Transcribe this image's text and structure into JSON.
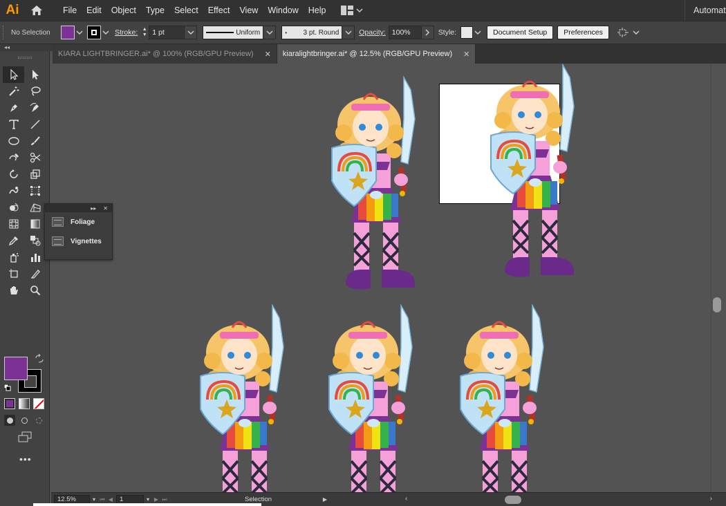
{
  "app": {
    "logo": "Ai",
    "workspace": "Automatic"
  },
  "menu": [
    "File",
    "Edit",
    "Object",
    "Type",
    "Select",
    "Effect",
    "View",
    "Window",
    "Help"
  ],
  "control": {
    "selection": "No Selection",
    "stroke_label": "Stroke:",
    "stroke_weight": "1 pt",
    "profile": "Uniform",
    "brush": "3 pt. Round",
    "opacity_label": "Opacity:",
    "opacity": "100%",
    "style_label": "Style:",
    "document_setup": "Document Setup",
    "preferences": "Preferences"
  },
  "colors": {
    "fill": "#7b3294",
    "stroke": "#000000",
    "accent": "#ff9a00"
  },
  "tabs": [
    {
      "label": "KIARA LIGHTBRINGER.ai* @ 100% (RGB/GPU Preview)",
      "active": false
    },
    {
      "label": "kiaralightbringer.ai* @ 12.5% (RGB/GPU Preview)",
      "active": true
    }
  ],
  "panel": {
    "items": [
      "Foliage",
      "Vignettes"
    ]
  },
  "status": {
    "zoom": "12.5%",
    "artboard": "1",
    "tool": "Selection"
  },
  "icons": [
    "home-icon",
    "arrange-documents-icon",
    "selection-tool-icon",
    "direct-selection-tool-icon",
    "magic-wand-icon",
    "lasso-icon",
    "pen-icon",
    "curvature-icon",
    "type-icon",
    "line-icon",
    "ellipse-icon",
    "paintbrush-icon",
    "shaper-icon",
    "scissors-icon",
    "rotate-icon",
    "scale-icon",
    "warp-icon",
    "free-transform-icon",
    "shape-builder-icon",
    "perspective-grid-icon",
    "mesh-icon",
    "gradient-icon",
    "eyedropper-icon",
    "blend-icon",
    "symbol-sprayer-icon",
    "column-graph-icon",
    "artboard-icon",
    "slice-icon",
    "hand-icon",
    "zoom-icon"
  ]
}
